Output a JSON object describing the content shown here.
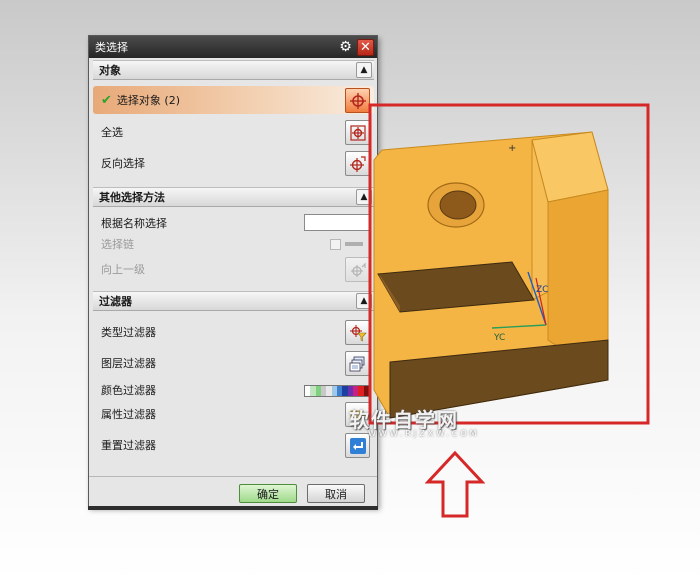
{
  "dialog": {
    "title": "类选择",
    "ok_label": "确定",
    "cancel_label": "取消"
  },
  "sections": {
    "object": {
      "header": "对象",
      "select_object": "选择对象 (2)",
      "select_all": "全选",
      "invert_selection": "反向选择"
    },
    "other": {
      "header": "其他选择方法",
      "select_by_name": "根据名称选择",
      "select_chain": "选择链",
      "up_one_level": "向上一级"
    },
    "filter": {
      "header": "过滤器",
      "type_filter": "类型过滤器",
      "layer_filter": "图层过滤器",
      "color_filter": "颜色过滤器",
      "attribute_filter": "属性过滤器",
      "reset_filter": "重置过滤器"
    }
  },
  "color_filter_swatches": [
    "#ffffff",
    "#bfe6bf",
    "#7fd07f",
    "#c8c8c8",
    "#e8e8e8",
    "#9fc9e8",
    "#3f7fcf",
    "#1f3fa0",
    "#6a2fb0",
    "#c82080",
    "#e02020",
    "#801010"
  ],
  "viewport": {
    "axis_labels": {
      "zc": "ZC",
      "yc": "YC"
    },
    "part_color": "#f5b545",
    "highlight_color": "#d62828"
  },
  "watermark": {
    "main": "软件自学网",
    "sub": "WWW.RJZXW.COM"
  },
  "colors": {
    "accent": "#f07c3e",
    "ok_button": "#9fd98a"
  }
}
